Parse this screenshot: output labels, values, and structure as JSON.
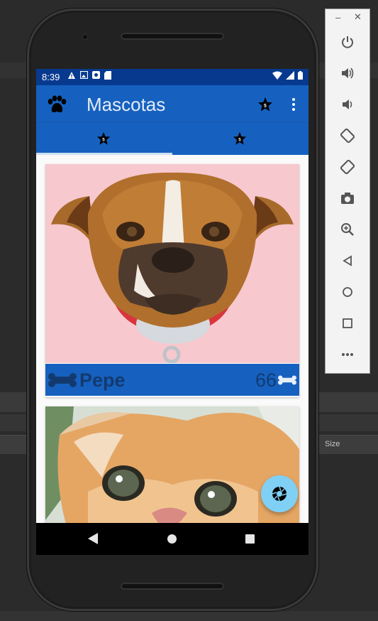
{
  "status_bar": {
    "time": "8:39"
  },
  "app_bar": {
    "title": "Mascotas",
    "leading_icon": "paw-icon",
    "actions": [
      "favorites-star-icon",
      "more-vert-icon"
    ]
  },
  "tabs": [
    {
      "icon": "favorites-star-icon",
      "selected": true
    },
    {
      "icon": "favorites-star-icon",
      "selected": false
    }
  ],
  "pets": [
    {
      "name": "Pepe",
      "likes": "66",
      "image": "boxer-dog-illustration"
    },
    {
      "name": "",
      "likes": "",
      "image": "orange-kitten-illustration"
    }
  ],
  "fab": {
    "icon": "camera-shutter-icon"
  },
  "emulator_panel": {
    "buttons": [
      "power-icon",
      "volume-up-icon",
      "volume-down-icon",
      "rotate-left-icon",
      "rotate-right-icon",
      "screenshot-camera-icon",
      "zoom-in-icon",
      "back-triangle-icon",
      "home-circle-icon",
      "overview-square-icon",
      "more-dots-icon"
    ]
  },
  "ide": {
    "size_label": "Size"
  },
  "colors": {
    "primary": "#1661bf",
    "primary_dark": "#073a8f",
    "accent": "#80d0f5",
    "text_dark": "#133a6f"
  }
}
